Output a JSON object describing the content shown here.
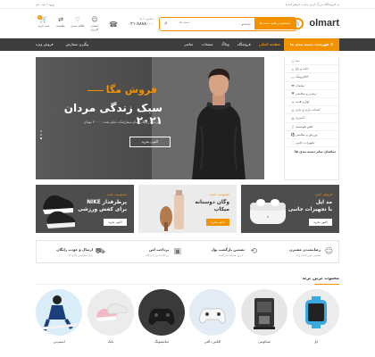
{
  "topbar": {
    "notice": "به فروشگاه بزرگ ایزی مارت خوش آمدید",
    "links": "ورود / ثبت نام"
  },
  "header": {
    "logo_text": "olmart",
    "search": {
      "category_label": "جستجو در همه دسته ها",
      "placeholder": "جستجو...",
      "select_label": "دسته ها"
    },
    "phone": {
      "label": "تماس با ما",
      "number": "۰۲۱-۸۸۸۸۰۰۰"
    },
    "icons": [
      {
        "name": "cart",
        "label": "سبد خرید",
        "badge": "0"
      },
      {
        "name": "compare",
        "label": "مقایسه"
      },
      {
        "name": "wishlist",
        "label": "علاقه مندی"
      },
      {
        "name": "account",
        "label": "حساب کاربری"
      }
    ]
  },
  "nav": {
    "category_button": "فهرست دسته بندی ها",
    "items": [
      "صفحه اصلی",
      "فروشگاه",
      "وبلاگ",
      "صفحات",
      "عناصر"
    ],
    "left_items": [
      "فروش ویژه",
      "پیگیری سفارش"
    ]
  },
  "sidebar": {
    "items": [
      "مد",
      "خانه و باغ",
      "الکترونیک",
      "مبلمان",
      "زیبایی و سلامتی",
      "لوازم هدیه",
      "اسباب بازی و بازی",
      "آشپزی",
      "تلفن هوشمند",
      "ورزش و سلامتی",
      "تجهیزات جانبی"
    ],
    "more_label": "تماشای تمام دسته بندی ها"
  },
  "hero": {
    "sale": "فروش مگا",
    "title": "سبک زندگی مردان ۲۰۲۱",
    "subtitle": "ارسال رایگان تمام سفارشات تمام شده ۲۰۰۰۰ تومان",
    "button": "اکنون بخرید"
  },
  "banners": [
    {
      "tag": "فروش ابدی",
      "title": "مد اپل\nبا تجهیزات جانبی",
      "button": "اکنون بخرید"
    },
    {
      "tag": "محبوبیت جدید",
      "title": "وگان دوستانه\nمیکاپ",
      "button": "اکنون بخرید"
    },
    {
      "tag": "محبوبیت جدید",
      "title": "پرطرفدار NIKE\nبرای کفش ورزشی",
      "button": "اکنون بخرید"
    }
  ],
  "features": [
    {
      "title": "رضایتمندی مشتری",
      "sub": "تضمین بازپرداخت وجه"
    },
    {
      "title": "تضمین بازگشت پول",
      "sub": "۳۰ روز ضمانت بازگشت"
    },
    {
      "title": "پرداخت امن",
      "sub": "پرداخت امن با درگاه"
    },
    {
      "title": "ارسال و عودت رایگان",
      "sub": "برای سفارش بالای ۹۹"
    }
  ],
  "brands": {
    "heading": "محبوب ترین برند",
    "items": [
      "اپل",
      "شیائومی",
      "الیاس دالتی",
      "سامسونگ",
      "نایک",
      "اسنپ‌بی"
    ]
  },
  "colors": {
    "accent": "#f39200",
    "nav_bg": "#3d3d3d"
  }
}
